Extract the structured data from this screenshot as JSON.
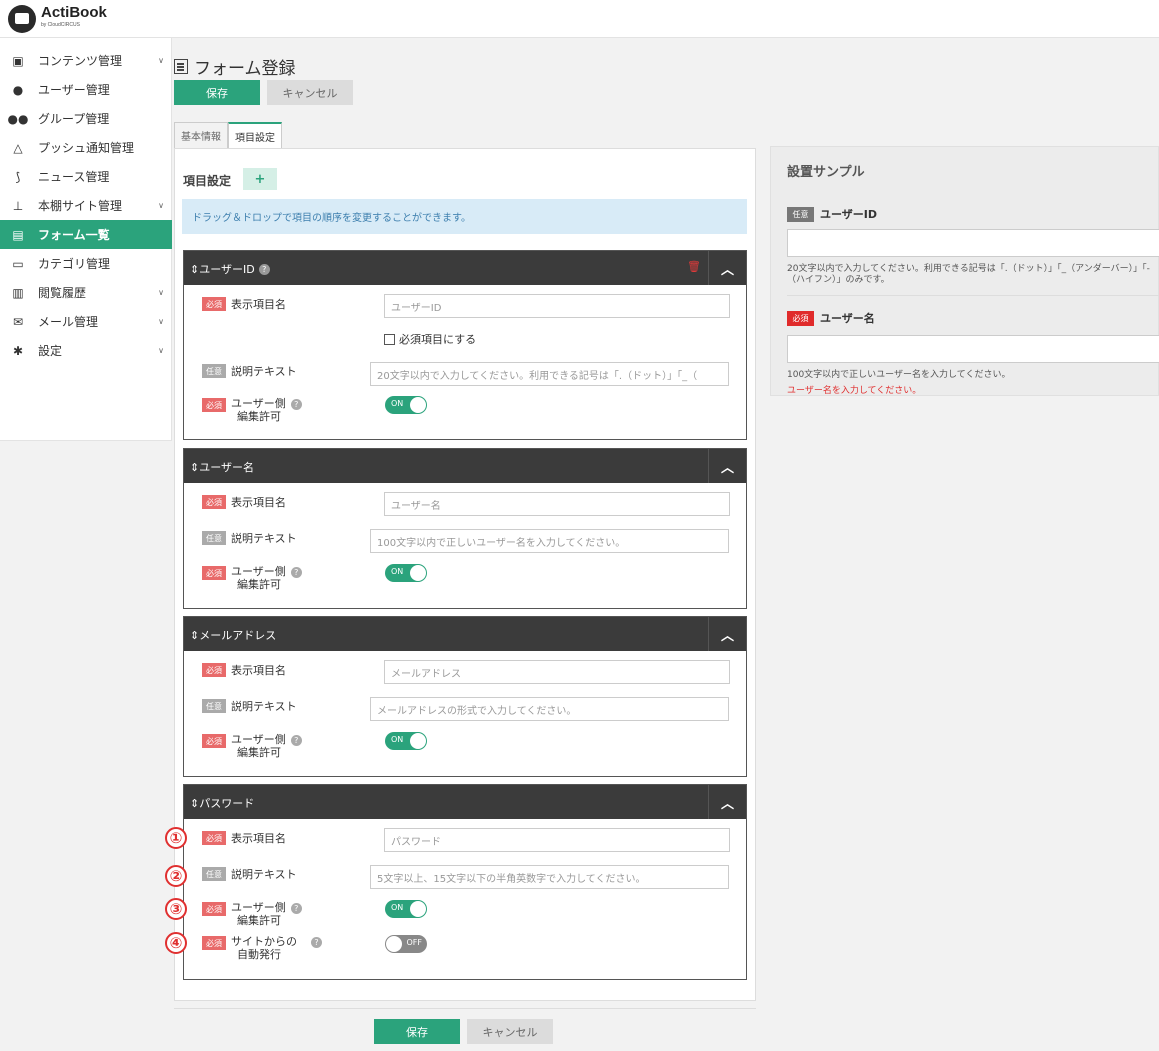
{
  "app": {
    "brand": "ActiBook",
    "brand_sub": "by CloudCIRCUS"
  },
  "sidebar": {
    "items": [
      {
        "label": "コンテンツ管理",
        "icon": "book-icon",
        "chevron": true
      },
      {
        "label": "ユーザー管理",
        "icon": "user-icon",
        "chevron": false
      },
      {
        "label": "グループ管理",
        "icon": "group-icon",
        "chevron": false
      },
      {
        "label": "プッシュ通知管理",
        "icon": "bell-icon",
        "chevron": false
      },
      {
        "label": "ニュース管理",
        "icon": "rss-icon",
        "chevron": false
      },
      {
        "label": "本棚サイト管理",
        "icon": "sitemap-icon",
        "chevron": true
      },
      {
        "label": "フォーム一覧",
        "icon": "form-icon",
        "chevron": false,
        "active": true
      },
      {
        "label": "カテゴリ管理",
        "icon": "folder-icon",
        "chevron": false
      },
      {
        "label": "閲覧履歴",
        "icon": "chart-icon",
        "chevron": true
      },
      {
        "label": "メール管理",
        "icon": "mail-icon",
        "chevron": true
      },
      {
        "label": "設定",
        "icon": "gear-icon",
        "chevron": true
      }
    ]
  },
  "page": {
    "title": "フォーム登録",
    "save_label": "保存",
    "cancel_label": "キャンセル",
    "tabs": [
      "基本情報",
      "項目設定"
    ],
    "section_title": "項目設定",
    "add_label": "+",
    "info_text": "ドラッグ＆ドロップで項目の順序を変更することができます。"
  },
  "labels": {
    "required": "必須",
    "optional": "任意",
    "display_name": "表示項目名",
    "description": "説明テキスト",
    "user_edit_1": "ユーザー側",
    "user_edit_2": "編集許可",
    "make_required": "必須項目にする",
    "auto_issue_1": "サイトからの",
    "auto_issue_2": "自動発行",
    "on": "ON",
    "off": "OFF",
    "qmark": "?"
  },
  "cards": [
    {
      "title": "ユーザーID",
      "name_placeholder": "ユーザーID",
      "desc_value": "20文字以内で入力してください。利用できる記号は「.（ドット）」「_（",
      "user_edit": "ON"
    },
    {
      "title": "ユーザー名",
      "name_placeholder": "ユーザー名",
      "desc_value": "100文字以内で正しいユーザー名を入力してください。",
      "user_edit": "ON"
    },
    {
      "title": "メールアドレス",
      "name_placeholder": "メールアドレス",
      "desc_value": "メールアドレスの形式で入力してください。",
      "user_edit": "ON"
    },
    {
      "title": "パスワード",
      "name_placeholder": "パスワード",
      "desc_value": "5文字以上、15文字以下の半角英数字で入力してください。",
      "user_edit": "ON",
      "auto_issue": "OFF"
    }
  ],
  "annotations": [
    "①",
    "②",
    "③",
    "④"
  ],
  "sample": {
    "title": "設置サンプル",
    "items": [
      {
        "badge": "任意",
        "label": "ユーザーID",
        "desc": "20文字以内で入力してください。利用できる記号は「.（ドット）」「_（アンダーバー）」「-（ハイフン）」のみです。"
      },
      {
        "badge": "必須",
        "label": "ユーザー名",
        "desc": "100文字以内で正しいユーザー名を入力してください。",
        "error": "ユーザー名を入力してください。"
      }
    ]
  },
  "colors": {
    "accent": "#2ba37c",
    "header_dark": "#3b3b3b",
    "required_badge": "#e86a6a",
    "error": "#e03030",
    "info_bg": "#d8ebf7"
  }
}
